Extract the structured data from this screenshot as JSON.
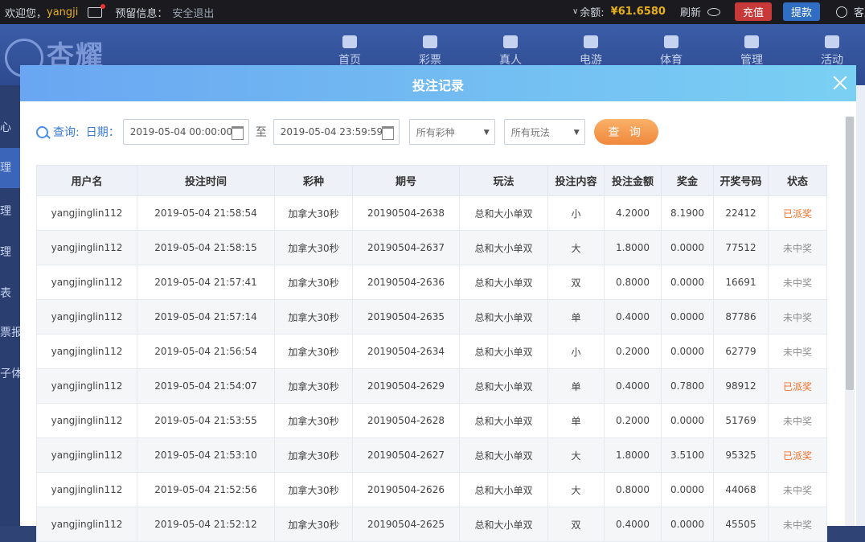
{
  "topbar": {
    "welcome": "欢迎您，",
    "username": "yangji",
    "reserved_label": "预留信息：",
    "logout": "安全退出",
    "balance_label": "余额:",
    "balance_value": "¥61.6580",
    "refresh": "刷新",
    "recharge": "充值",
    "withdraw": "提款",
    "service": "客服"
  },
  "header": {
    "logo_text": "杏耀",
    "nav": [
      "首页",
      "彩票",
      "真人",
      "电游",
      "体育",
      "管理",
      "活动"
    ]
  },
  "sidebar": {
    "items": [
      "心",
      "理",
      "理",
      "理",
      "表",
      "票报",
      "子体"
    ]
  },
  "modal": {
    "title": "投注记录",
    "query_label": "查询:",
    "date_label": "日期：",
    "date_start": "2019-05-04 00:00:00",
    "to_label": "至",
    "date_end": "2019-05-04 23:59:59",
    "lottery_select": "所有彩种",
    "play_select": "所有玩法",
    "query_button": "查 询"
  },
  "table": {
    "headers": [
      "用户名",
      "投注时间",
      "彩种",
      "期号",
      "玩法",
      "投注内容",
      "投注金额",
      "奖金",
      "开奖号码",
      "状态"
    ],
    "rows": [
      [
        "yangjinglin112",
        "2019-05-04 21:58:54",
        "加拿大30秒",
        "20190504-2638",
        "总和大小单双",
        "小",
        "4.2000",
        "8.1900",
        "22412",
        "已派奖"
      ],
      [
        "yangjinglin112",
        "2019-05-04 21:58:15",
        "加拿大30秒",
        "20190504-2637",
        "总和大小单双",
        "大",
        "1.8000",
        "0.0000",
        "77512",
        "未中奖"
      ],
      [
        "yangjinglin112",
        "2019-05-04 21:57:41",
        "加拿大30秒",
        "20190504-2636",
        "总和大小单双",
        "双",
        "0.8000",
        "0.0000",
        "16691",
        "未中奖"
      ],
      [
        "yangjinglin112",
        "2019-05-04 21:57:14",
        "加拿大30秒",
        "20190504-2635",
        "总和大小单双",
        "单",
        "0.4000",
        "0.0000",
        "87786",
        "未中奖"
      ],
      [
        "yangjinglin112",
        "2019-05-04 21:56:54",
        "加拿大30秒",
        "20190504-2634",
        "总和大小单双",
        "小",
        "0.2000",
        "0.0000",
        "62779",
        "未中奖"
      ],
      [
        "yangjinglin112",
        "2019-05-04 21:54:07",
        "加拿大30秒",
        "20190504-2629",
        "总和大小单双",
        "单",
        "0.4000",
        "0.7800",
        "98912",
        "已派奖"
      ],
      [
        "yangjinglin112",
        "2019-05-04 21:53:55",
        "加拿大30秒",
        "20190504-2628",
        "总和大小单双",
        "单",
        "0.2000",
        "0.0000",
        "51769",
        "未中奖"
      ],
      [
        "yangjinglin112",
        "2019-05-04 21:53:10",
        "加拿大30秒",
        "20190504-2627",
        "总和大小单双",
        "大",
        "1.8000",
        "3.5100",
        "95325",
        "已派奖"
      ],
      [
        "yangjinglin112",
        "2019-05-04 21:52:56",
        "加拿大30秒",
        "20190504-2626",
        "总和大小单双",
        "大",
        "0.8000",
        "0.0000",
        "44068",
        "未中奖"
      ],
      [
        "yangjinglin112",
        "2019-05-04 21:52:12",
        "加拿大30秒",
        "20190504-2625",
        "总和大小单双",
        "双",
        "0.4000",
        "0.0000",
        "45505",
        "未中奖"
      ]
    ]
  }
}
